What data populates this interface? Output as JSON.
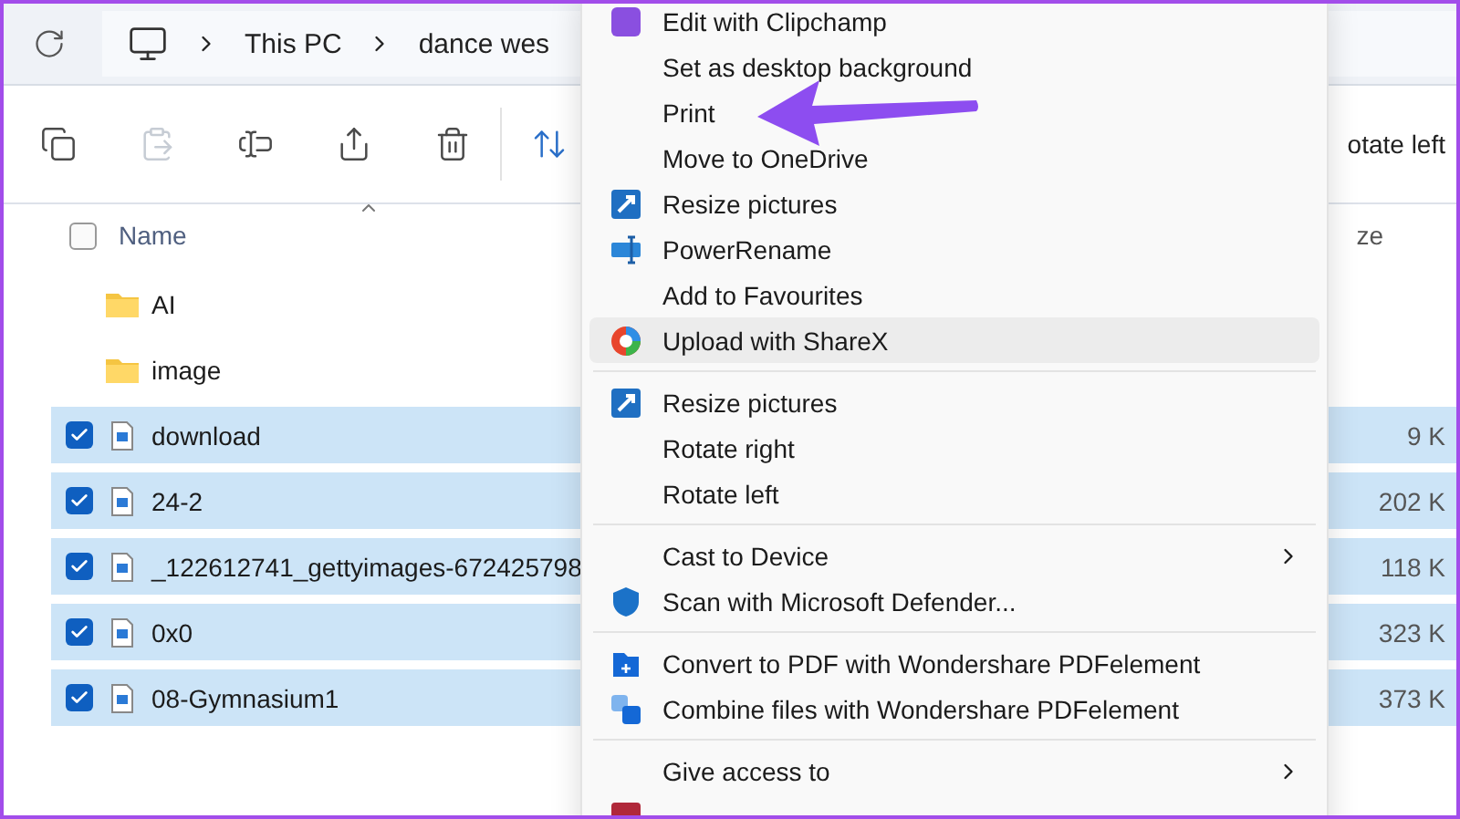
{
  "address_bar": {
    "segments": [
      "This PC",
      "dance wes"
    ]
  },
  "toolbar": {
    "buttons": [
      {
        "disabled": false
      },
      {
        "disabled": true
      },
      {
        "disabled": false
      },
      {
        "disabled": false
      },
      {
        "disabled": false
      },
      {
        "disabled": false
      }
    ],
    "cut_label": "otate left"
  },
  "file_list": {
    "columns": {
      "name": "Name",
      "column_2": "ze"
    },
    "all_checked": false,
    "rows": [
      {
        "kind": "folder",
        "name": "AI",
        "selected": false
      },
      {
        "kind": "folder",
        "name": "image",
        "selected": false
      },
      {
        "kind": "file",
        "name": "download",
        "selected": true,
        "size": "9 K"
      },
      {
        "kind": "file",
        "name": "24-2",
        "selected": true,
        "size": "202 K"
      },
      {
        "kind": "file",
        "name": "_122612741_gettyimages-672425798",
        "selected": true,
        "size": "118 K"
      },
      {
        "kind": "file",
        "name": "0x0",
        "selected": true,
        "size": "323 K"
      },
      {
        "kind": "file",
        "name": "08-Gymnasium1",
        "selected": true,
        "size": "373 K"
      }
    ]
  },
  "context_menu": {
    "groups": [
      [
        {
          "label": "Edit with Clipchamp",
          "hovered": false,
          "submenu": false
        },
        {
          "label": "Set as desktop background",
          "hovered": false,
          "submenu": false
        },
        {
          "label": "Print",
          "hovered": false,
          "submenu": false
        },
        {
          "label": "Move to OneDrive",
          "hovered": false,
          "submenu": false
        },
        {
          "label": "Resize pictures",
          "hovered": false,
          "submenu": false
        },
        {
          "label": "PowerRename",
          "hovered": false,
          "submenu": false
        },
        {
          "label": "Add to Favourites",
          "hovered": false,
          "submenu": false
        },
        {
          "label": "Upload with ShareX",
          "hovered": true,
          "submenu": false
        }
      ],
      [
        {
          "label": "Resize pictures",
          "hovered": false,
          "submenu": false
        },
        {
          "label": "Rotate right",
          "hovered": false,
          "submenu": false
        },
        {
          "label": "Rotate left",
          "hovered": false,
          "submenu": false
        }
      ],
      [
        {
          "label": "Cast to Device",
          "hovered": false,
          "submenu": true
        },
        {
          "label": "Scan with Microsoft Defender...",
          "hovered": false,
          "submenu": false
        }
      ],
      [
        {
          "label": "Convert to PDF with Wondershare PDFelement",
          "hovered": false,
          "submenu": false
        },
        {
          "label": "Combine files with Wondershare PDFelement",
          "hovered": false,
          "submenu": false
        }
      ],
      [
        {
          "label": "Give access to",
          "hovered": false,
          "submenu": true
        }
      ]
    ]
  }
}
